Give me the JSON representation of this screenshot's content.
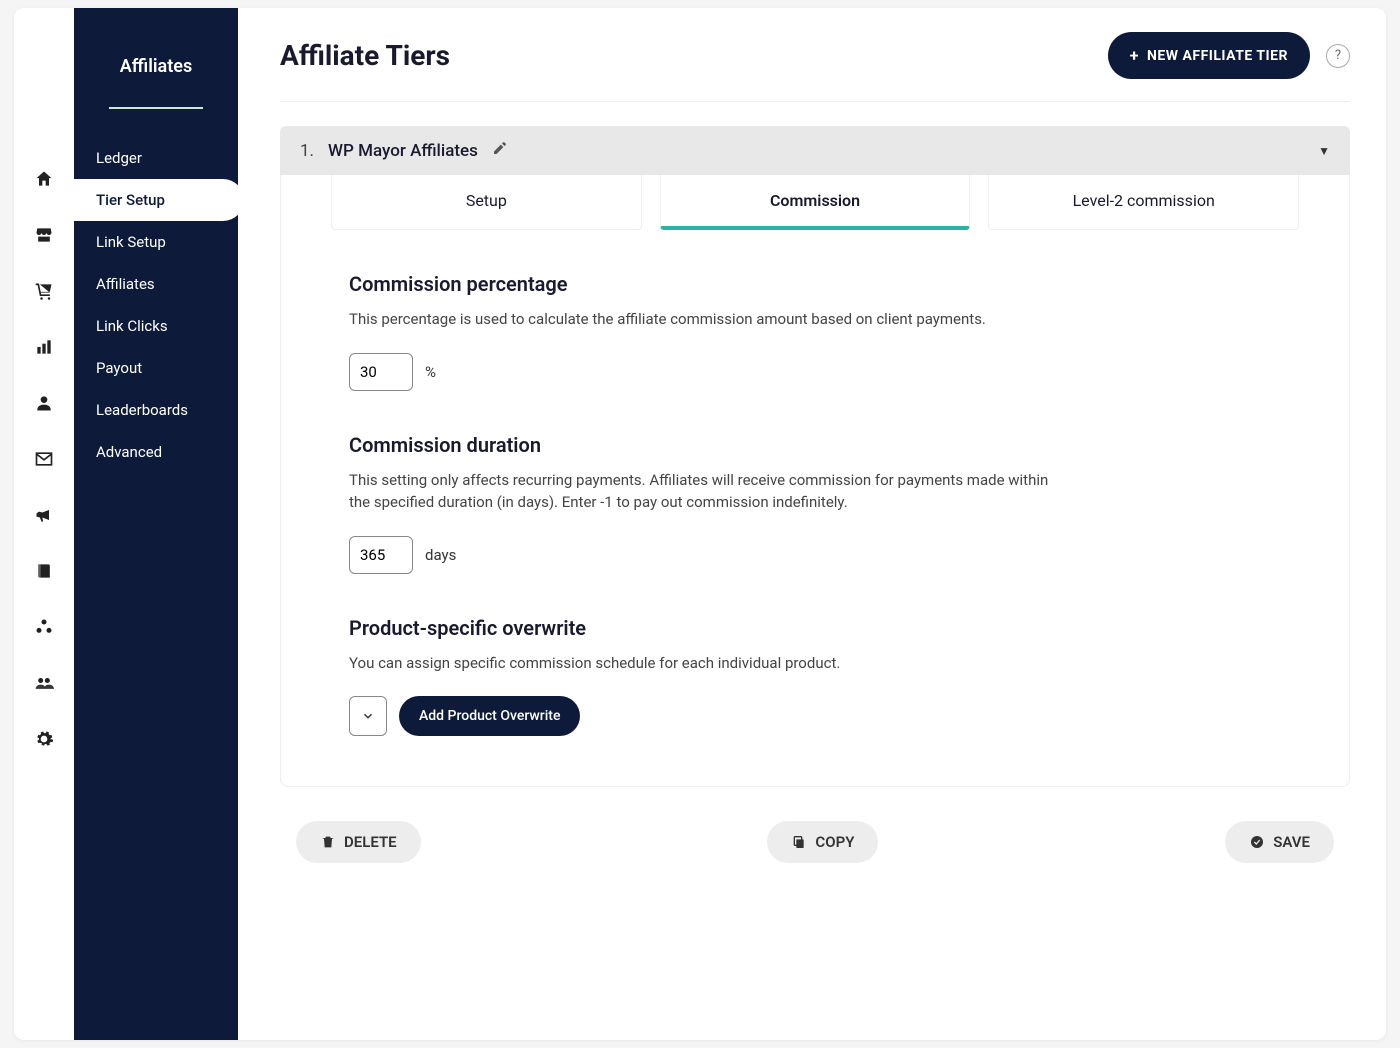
{
  "sidebar": {
    "title": "Affiliates",
    "items": [
      "Ledger",
      "Tier Setup",
      "Link Setup",
      "Affiliates",
      "Link Clicks",
      "Payout",
      "Leaderboards",
      "Advanced"
    ],
    "active_index": 1
  },
  "header": {
    "title": "Affiliate Tiers",
    "new_button": "NEW AFFILIATE TIER",
    "help": "?"
  },
  "tier": {
    "index": "1.",
    "name": "WP Mayor Affiliates"
  },
  "tabs": {
    "items": [
      "Setup",
      "Commission",
      "Level-2 commission"
    ],
    "active_index": 1
  },
  "commission_pct": {
    "heading": "Commission percentage",
    "desc": "This percentage is used to calculate the affiliate commission amount based on client payments.",
    "value": "30",
    "unit": "%"
  },
  "commission_dur": {
    "heading": "Commission duration",
    "desc": "This setting only affects recurring payments. Affiliates will receive commission for payments made within the specified duration (in days). Enter -1 to pay out commission indefinitely.",
    "value": "365",
    "unit": "days"
  },
  "overwrite": {
    "heading": "Product-specific overwrite",
    "desc": "You can assign specific commission schedule for each individual product.",
    "button": "Add Product Overwrite"
  },
  "footer": {
    "delete": "DELETE",
    "copy": "COPY",
    "save": "SAVE"
  }
}
